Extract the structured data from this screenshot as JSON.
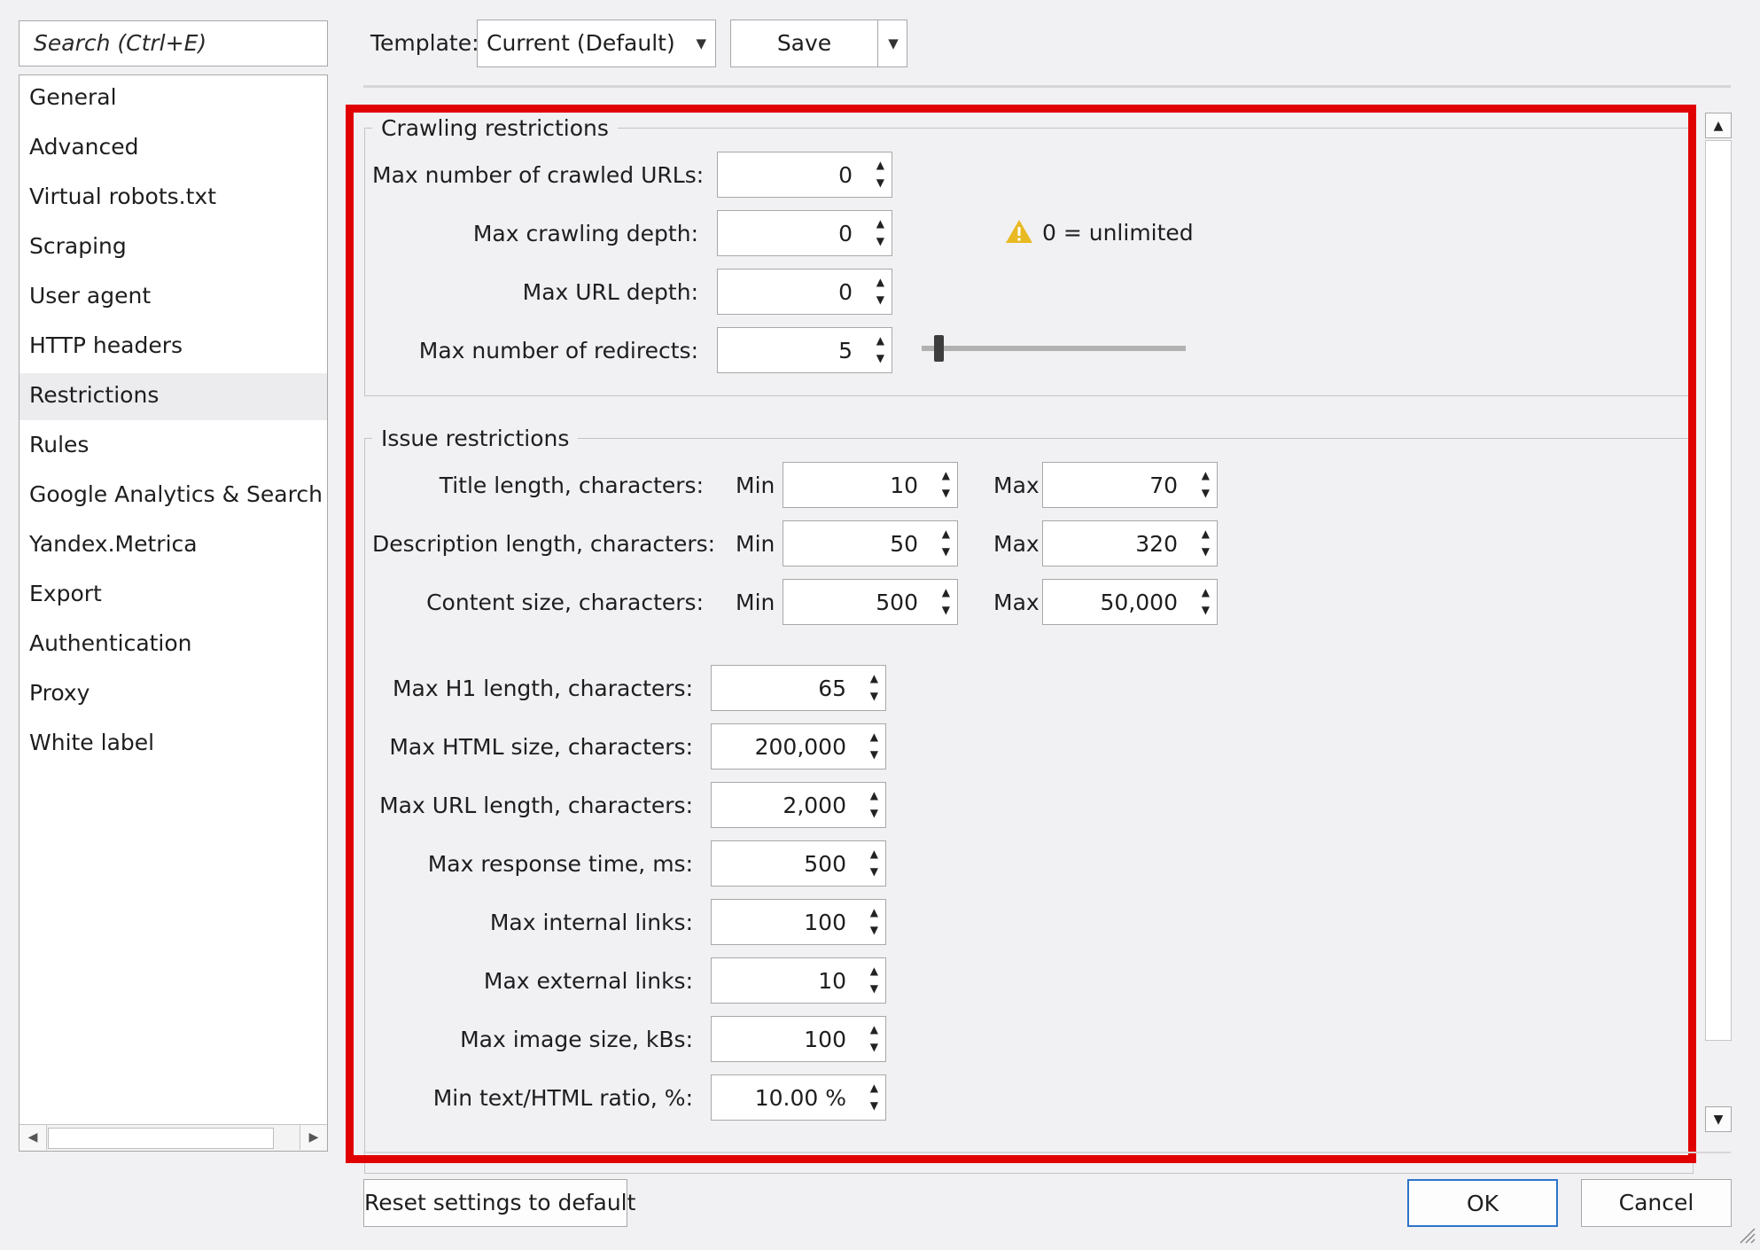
{
  "search": {
    "placeholder": "Search (Ctrl+E)"
  },
  "sidebar": {
    "selected": "Restrictions",
    "items": [
      "General",
      "Advanced",
      "Virtual robots.txt",
      "Scraping",
      "User agent",
      "HTTP headers",
      "Restrictions",
      "Rules",
      "Google Analytics & Search Co",
      "Yandex.Metrica",
      "Export",
      "Authentication",
      "Proxy",
      "White label"
    ]
  },
  "toolbar": {
    "template_label": "Template:",
    "template_value": "Current (Default)",
    "save_label": "Save"
  },
  "crawling": {
    "title": "Crawling restrictions",
    "max_urls": {
      "label": "Max number of crawled URLs:",
      "value": "0"
    },
    "max_depth": {
      "label": "Max crawling depth:",
      "value": "0"
    },
    "max_url_depth": {
      "label": "Max URL depth:",
      "value": "0"
    },
    "max_redirects": {
      "label": "Max number of redirects:",
      "value": "5",
      "slider_fraction": 0.05
    },
    "note": "0 = unlimited"
  },
  "issue": {
    "title": "Issue restrictions",
    "min_label": "Min",
    "max_label": "Max",
    "ranges": [
      {
        "label": "Title length, characters:",
        "min": "10",
        "max": "70"
      },
      {
        "label": "Description length, characters:",
        "min": "50",
        "max": "320"
      },
      {
        "label": "Content size, characters:",
        "min": "500",
        "max": "50,000"
      }
    ],
    "fields": [
      {
        "label": "Max H1 length, characters:",
        "value": "65"
      },
      {
        "label": "Max HTML size, characters:",
        "value": "200,000"
      },
      {
        "label": "Max URL length, characters:",
        "value": "2,000"
      },
      {
        "label": "Max response time, ms:",
        "value": "500"
      },
      {
        "label": "Max internal links:",
        "value": "100"
      },
      {
        "label": "Max external links:",
        "value": "10"
      },
      {
        "label": "Max image size, kBs:",
        "value": "100"
      },
      {
        "label": "Min text/HTML ratio, %:",
        "value": "10.00 %"
      }
    ]
  },
  "footer": {
    "reset_label": "Reset settings to default",
    "ok_label": "OK",
    "cancel_label": "Cancel"
  },
  "colors": {
    "highlight": "#e00000",
    "warning": "#e8b923",
    "ok_border": "#2e74c9"
  }
}
